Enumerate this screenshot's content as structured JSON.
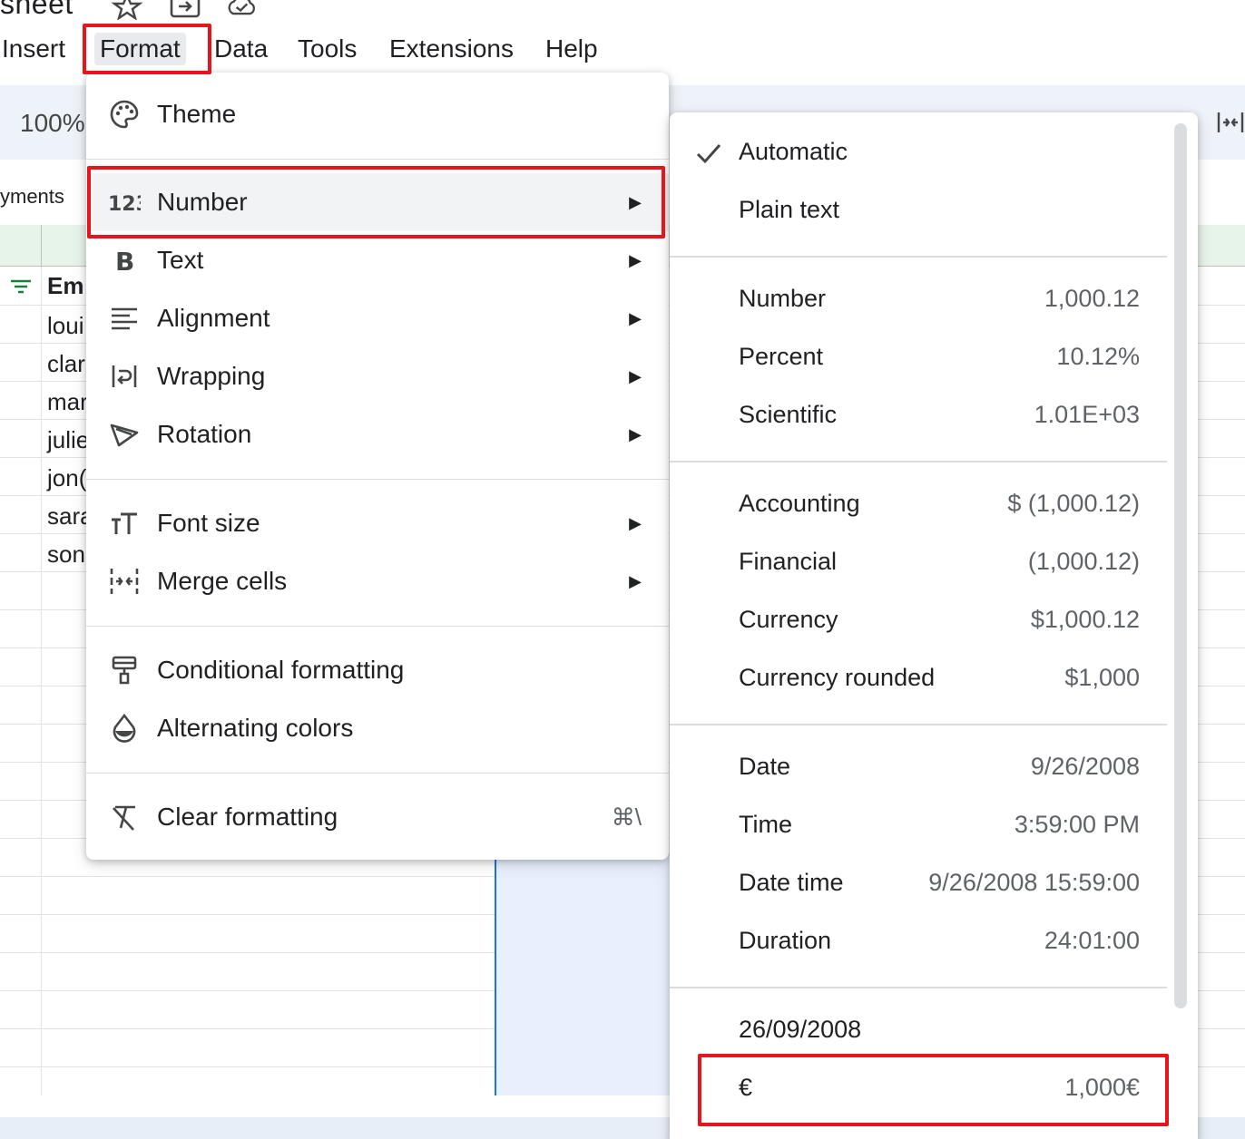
{
  "app": {
    "doc_title": "sheet"
  },
  "menubar": {
    "items": [
      "Insert",
      "Format",
      "Data",
      "Tools",
      "Extensions",
      "Help"
    ],
    "active": "Format"
  },
  "toolbar": {
    "zoom": "100%"
  },
  "sheet": {
    "tab_label": "yments",
    "header_cell": "Em",
    "rows": [
      "loui",
      "clar",
      "mar",
      "julie",
      "jon(",
      "sara",
      "son"
    ]
  },
  "format_menu": {
    "items": [
      {
        "label": "Theme",
        "icon": "palette-icon",
        "submenu": false
      },
      {
        "label": "Number",
        "icon": "number-format-icon",
        "submenu": true
      },
      {
        "label": "Text",
        "icon": "bold-icon",
        "submenu": true
      },
      {
        "label": "Alignment",
        "icon": "align-left-icon",
        "submenu": true
      },
      {
        "label": "Wrapping",
        "icon": "wrap-icon",
        "submenu": true
      },
      {
        "label": "Rotation",
        "icon": "rotation-icon",
        "submenu": true
      },
      {
        "label": "Font size",
        "icon": "font-size-icon",
        "submenu": true
      },
      {
        "label": "Merge cells",
        "icon": "merge-cells-icon",
        "submenu": true
      },
      {
        "label": "Conditional formatting",
        "icon": "paint-roller-icon",
        "submenu": false
      },
      {
        "label": "Alternating colors",
        "icon": "drop-icon",
        "submenu": false
      },
      {
        "label": "Clear formatting",
        "icon": "clear-format-icon",
        "submenu": false,
        "shortcut": "⌘\\"
      }
    ]
  },
  "number_submenu": {
    "items": [
      {
        "label": "Automatic",
        "example": "",
        "checked": true
      },
      {
        "label": "Plain text",
        "example": ""
      },
      {
        "label": "Number",
        "example": "1,000.12"
      },
      {
        "label": "Percent",
        "example": "10.12%"
      },
      {
        "label": "Scientific",
        "example": "1.01E+03"
      },
      {
        "label": "Accounting",
        "example": "$ (1,000.12)"
      },
      {
        "label": "Financial",
        "example": "(1,000.12)"
      },
      {
        "label": "Currency",
        "example": "$1,000.12"
      },
      {
        "label": "Currency rounded",
        "example": "$1,000"
      },
      {
        "label": "Date",
        "example": "9/26/2008"
      },
      {
        "label": "Time",
        "example": "3:59:00 PM"
      },
      {
        "label": "Date time",
        "example": "9/26/2008 15:59:00"
      },
      {
        "label": "Duration",
        "example": "24:01:00"
      },
      {
        "label": "26/09/2008",
        "example": ""
      },
      {
        "label": "€",
        "example": "1,000€"
      }
    ]
  },
  "colors": {
    "highlight_box": "#e8141c",
    "accent": "#1a73e8",
    "toolbar_bg": "#eef2f9"
  }
}
